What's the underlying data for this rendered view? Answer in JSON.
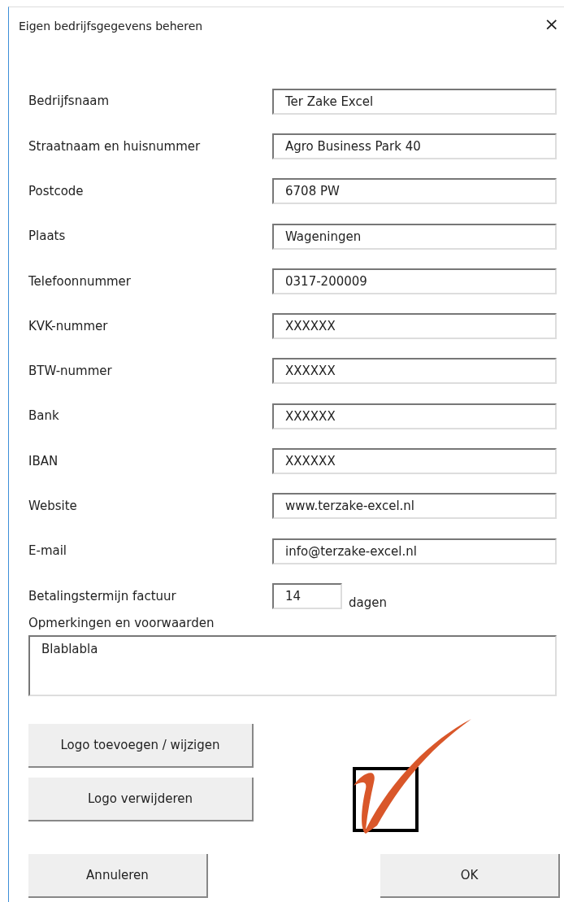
{
  "window": {
    "title": "Eigen bedrijfsgegevens beheren",
    "close": "×"
  },
  "fields": [
    {
      "label": "Bedrijfsnaam",
      "value": "Ter Zake Excel"
    },
    {
      "label": "Straatnaam en huisnummer",
      "value": "Agro Business Park 40"
    },
    {
      "label": "Postcode",
      "value": "6708 PW"
    },
    {
      "label": "Plaats",
      "value": "Wageningen"
    },
    {
      "label": "Telefoonnummer",
      "value": "0317-200009"
    },
    {
      "label": "KVK-nummer",
      "value": "XXXXXX"
    },
    {
      "label": "BTW-nummer",
      "value": "XXXXXX"
    },
    {
      "label": "Bank",
      "value": "XXXXXX"
    },
    {
      "label": "IBAN",
      "value": "XXXXXX"
    },
    {
      "label": "Website",
      "value": "www.terzake-excel.nl"
    },
    {
      "label": "E-mail",
      "value": "info@terzake-excel.nl"
    }
  ],
  "payment_term": {
    "label": "Betalingstermijn factuur",
    "value": "14",
    "unit": "dagen"
  },
  "remarks": {
    "label": "Opmerkingen en voorwaarden",
    "value": "Blablabla"
  },
  "logo_buttons": [
    "Logo toevoegen / wijzigen",
    "Logo verwijderen"
  ],
  "buttons": [
    "Annuleren",
    "OK"
  ]
}
